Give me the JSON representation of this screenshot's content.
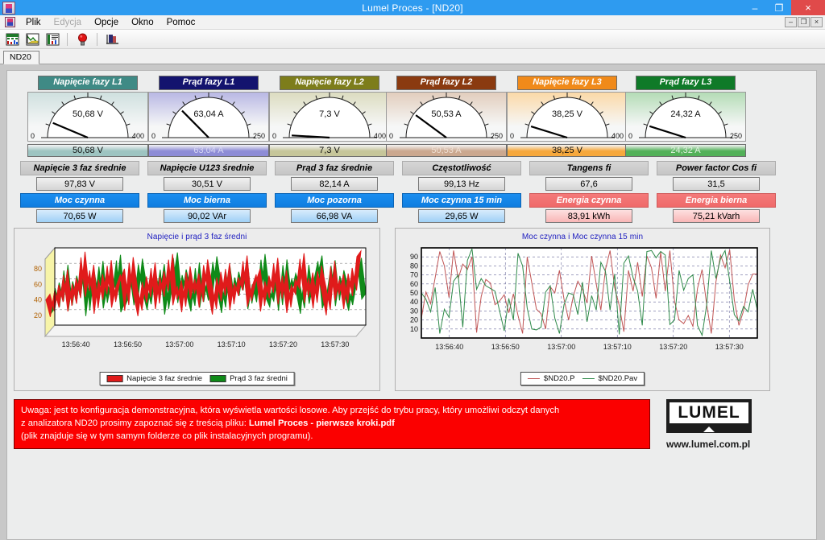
{
  "titlebar": {
    "title": "Lumel Proces - [ND20]",
    "minimize": "–",
    "restore": "❐",
    "close": "×",
    "accent": "#2e9bf0",
    "close_color": "#e04a4a"
  },
  "menubar": {
    "items": [
      {
        "label": "Plik",
        "disabled": false
      },
      {
        "label": "Edycja",
        "disabled": true
      },
      {
        "label": "Opcje",
        "disabled": false
      },
      {
        "label": "Okno",
        "disabled": false
      },
      {
        "label": "Pomoc",
        "disabled": false
      }
    ],
    "mdi_buttons": [
      {
        "name": "mdi-minimize",
        "label": "–"
      },
      {
        "name": "mdi-restore",
        "label": "❐"
      },
      {
        "name": "mdi-close",
        "label": "×"
      }
    ]
  },
  "toolbar": {
    "buttons": [
      {
        "name": "table-view-icon",
        "title": "Tabela"
      },
      {
        "name": "chart-view-icon",
        "title": "Wykres"
      },
      {
        "name": "report-view-icon",
        "title": "Raport"
      },
      {
        "name": "alarm-lamp-icon",
        "title": "Alarmy"
      },
      {
        "name": "archive-icon",
        "title": "Archiwum"
      }
    ]
  },
  "tabstrip": {
    "active_tab": "ND20"
  },
  "gauges": [
    {
      "name": "voltage-l1",
      "title": "Napięcie fazy L1",
      "value": "50,68 V",
      "readout": "50,68 V",
      "min": "0",
      "max": "400",
      "numeric": 50.68,
      "range_max": 400,
      "unit": "V",
      "header_bg": "#3f8a85",
      "face_bg": "#cfe0df",
      "readout_bg": "#9dc4c1",
      "readout_color": "#111111"
    },
    {
      "name": "current-l1",
      "title": "Prąd fazy L1",
      "value": "63,04 A",
      "readout": "63,04 A",
      "min": "0",
      "max": "250",
      "numeric": 63.04,
      "range_max": 250,
      "unit": "A",
      "header_bg": "#13136e",
      "face_bg": "#b9b8e4",
      "readout_bg": "#8d8cd6",
      "readout_color": "#d8d8f4"
    },
    {
      "name": "voltage-l2",
      "title": "Napięcie fazy L2",
      "value": "7,3 V",
      "readout": "7,3 V",
      "min": "0",
      "max": "400",
      "numeric": 7.3,
      "range_max": 400,
      "unit": "V",
      "header_bg": "#7d7d1b",
      "face_bg": "#dcdcc0",
      "readout_bg": "#c6c69a",
      "readout_color": "#111111"
    },
    {
      "name": "current-l2",
      "title": "Prąd fazy L2",
      "value": "50,53 A",
      "readout": "50,53 A",
      "min": "0",
      "max": "250",
      "numeric": 50.53,
      "range_max": 250,
      "unit": "A",
      "header_bg": "#8a3a10",
      "face_bg": "#e2cdbd",
      "readout_bg": "#cba88f",
      "readout_color": "#efe0d4"
    },
    {
      "name": "voltage-l3",
      "title": "Napięcie fazy L3",
      "value": "38,25 V",
      "readout": "38,25 V",
      "min": "0",
      "max": "400",
      "numeric": 38.25,
      "range_max": 400,
      "unit": "V",
      "header_bg": "#f08a1a",
      "face_bg": "#fbd9a8",
      "readout_bg": "#f6a83c",
      "readout_color": "#111111"
    },
    {
      "name": "current-l3",
      "title": "Prąd fazy L3",
      "value": "24,32 A",
      "readout": "24,32 A",
      "min": "0",
      "max": "250",
      "numeric": 24.32,
      "range_max": 250,
      "unit": "A",
      "header_bg": "#0f7a28",
      "face_bg": "#b4dcb6",
      "readout_bg": "#53b159",
      "readout_color": "#dff0df"
    }
  ],
  "measurements": {
    "row1": [
      {
        "name": "voltage-3ph-avg",
        "header": "Napięcie 3 faz średnie",
        "value": "97,83 V",
        "style": "grey"
      },
      {
        "name": "voltage-u123-avg",
        "header": "Napięcie U123 średnie",
        "value": "30,51 V",
        "style": "grey"
      },
      {
        "name": "current-3ph-avg",
        "header": "Prąd 3 faz średnie",
        "value": "82,14 A",
        "style": "grey"
      },
      {
        "name": "frequency",
        "header": "Częstotliwość",
        "value": "99,13 Hz",
        "style": "grey"
      },
      {
        "name": "tangens-fi",
        "header": "Tangens fi",
        "value": "67,6",
        "style": "grey"
      },
      {
        "name": "power-factor",
        "header": "Power factor Cos fi",
        "value": "31,5",
        "style": "grey"
      }
    ],
    "row2": [
      {
        "name": "active-power",
        "header": "Moc czynna",
        "value": "70,65 W",
        "style": "blue"
      },
      {
        "name": "reactive-power",
        "header": "Moc bierna",
        "value": "90,02 VAr",
        "style": "blue"
      },
      {
        "name": "apparent-power",
        "header": "Moc pozorna",
        "value": "66,98 VA",
        "style": "blue"
      },
      {
        "name": "active-power-15min",
        "header": "Moc czynna 15 min",
        "value": "29,65 W",
        "style": "blue"
      },
      {
        "name": "active-energy",
        "header": "Energia czynna",
        "value": "83,91 kWh",
        "style": "red"
      },
      {
        "name": "reactive-energy",
        "header": "Energia bierna",
        "value": "75,21 kVarh",
        "style": "red"
      }
    ]
  },
  "chart_data": [
    {
      "name": "chart-voltage-current",
      "type": "area",
      "title": "Napięcie i prąd 3 faz średni",
      "xlabel": "",
      "ylabel": "",
      "ylim": [
        0,
        100
      ],
      "yticks": [
        20,
        40,
        60,
        80
      ],
      "grid": true,
      "legend_position": "bottom",
      "xticks": [
        "13:56:40",
        "13:56:50",
        "13:57:00",
        "13:57:10",
        "13:57:20",
        "13:57:30"
      ],
      "series": [
        {
          "name": "Napięcie 3 faz średnie",
          "color": "#e01b1b",
          "values": [
            40,
            18,
            52,
            30,
            72,
            25,
            61,
            35,
            95,
            44,
            78,
            22,
            66,
            40,
            84,
            30,
            57,
            73,
            26,
            88,
            47,
            19,
            63,
            36,
            81,
            28,
            70,
            44,
            92,
            33,
            58,
            24,
            76,
            41,
            67,
            30,
            85,
            52,
            21,
            69,
            38,
            80,
            27,
            62,
            45,
            90,
            31,
            56,
            73,
            25,
            64,
            42,
            87,
            34,
            71,
            23,
            59,
            47,
            93,
            36,
            68,
            29,
            77,
            50,
            20,
            83,
            39,
            66,
            28,
            74,
            45,
            96
          ]
        },
        {
          "name": "Prąd 3 faz średni",
          "color": "#0f8a18",
          "values": [
            22,
            55,
            31,
            78,
            26,
            64,
            41,
            88,
            19,
            70,
            35,
            83,
            29,
            59,
            46,
            91,
            24,
            38,
            75,
            33,
            86,
            50,
            27,
            68,
            42,
            79,
            21,
            57,
            94,
            36,
            72,
            48,
            25,
            81,
            30,
            65,
            39,
            89,
            53,
            23,
            76,
            34,
            69,
            45,
            82,
            28,
            60,
            37,
            92,
            44,
            31,
            73,
            26,
            85,
            40,
            67,
            51,
            22,
            78,
            35,
            63,
            90,
            29,
            46,
            84,
            32,
            71,
            49,
            26,
            58,
            87,
            41
          ]
        }
      ]
    },
    {
      "name": "chart-active-power",
      "type": "line",
      "title": "Moc czynna i Moc czynna 15 min",
      "xlabel": "",
      "ylabel": "",
      "ylim": [
        0,
        100
      ],
      "yticks": [
        10,
        20,
        30,
        40,
        50,
        60,
        70,
        80,
        90
      ],
      "grid": true,
      "legend_position": "bottom",
      "xticks": [
        "13:56:40",
        "13:56:50",
        "13:57:00",
        "13:57:10",
        "13:57:20",
        "13:57:30"
      ],
      "series": [
        {
          "name": "$ND20.P",
          "color": "#c05555",
          "values": [
            22,
            51,
            38,
            67,
            96,
            80,
            45,
            97,
            66,
            82,
            76,
            90,
            6,
            46,
            65,
            61,
            37,
            41,
            48,
            28,
            49,
            25,
            5,
            90,
            61,
            32,
            27,
            10,
            57,
            50,
            75,
            43,
            20,
            46,
            63,
            54,
            39,
            91,
            60,
            31,
            76,
            97,
            56,
            36,
            7,
            75,
            52,
            84,
            46,
            91,
            78,
            44,
            95,
            52,
            97,
            41,
            20,
            16,
            25,
            13,
            55,
            76,
            37,
            5,
            62,
            92,
            78,
            98,
            42,
            14,
            30,
            59,
            71,
            71
          ]
        },
        {
          "name": "$ND20.Pav",
          "color": "#2f8a4a",
          "values": [
            50,
            43,
            29,
            56,
            5,
            32,
            23,
            63,
            70,
            12,
            86,
            99,
            54,
            66,
            58,
            55,
            52,
            30,
            8,
            44,
            20,
            94,
            80,
            33,
            10,
            9,
            12,
            51,
            58,
            22,
            5,
            37,
            50,
            48,
            26,
            62,
            18,
            47,
            31,
            84,
            74,
            31,
            71,
            4,
            83,
            91,
            67,
            52,
            14,
            96,
            97,
            89,
            96,
            92,
            15,
            20,
            75,
            53,
            66,
            70,
            14,
            3,
            37,
            97,
            66,
            88,
            97,
            63,
            26,
            19,
            35,
            29,
            54,
            31
          ]
        }
      ]
    }
  ],
  "notice": {
    "line1_a": "Uwaga: jest to konfiguracja demonstracyjna, która wyświetla wartości losowe. Aby przejść do trybu pracy, który umożliwi odczyt danych",
    "line2_a": "z analizatora ND20 prosimy zapoznać się z treścią pliku: ",
    "line2_b": "Lumel Proces - pierwsze kroki.pdf",
    "line3_a": "(plik znajduje się w tym samym folderze co plik instalacyjnych programu).",
    "bg": "#fb0000"
  },
  "logo": {
    "wordmark": "LUMEL",
    "url": "www.lumel.com.pl"
  }
}
